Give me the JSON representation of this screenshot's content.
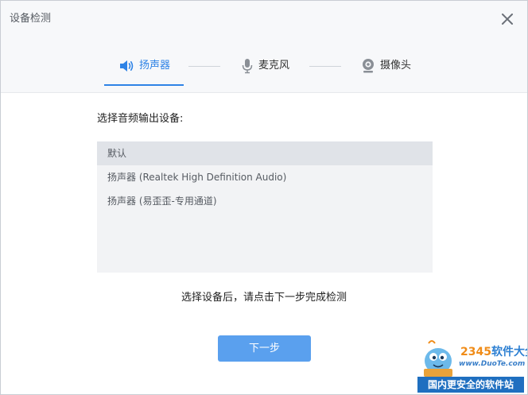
{
  "window": {
    "title": "设备检测"
  },
  "tabs": [
    {
      "label": "扬声器",
      "icon": "speaker-icon",
      "active": true
    },
    {
      "label": "麦克风",
      "icon": "microphone-icon",
      "active": false
    },
    {
      "label": "摄像头",
      "icon": "camera-icon",
      "active": false
    }
  ],
  "main": {
    "prompt": "选择音频输出设备:",
    "devices": [
      {
        "label": "默认",
        "selected": true
      },
      {
        "label": "扬声器 (Realtek High Definition Audio)",
        "selected": false
      },
      {
        "label": "扬声器 (易歪歪-专用通道)",
        "selected": false
      }
    ],
    "hint": "选择设备后，请点击下一步完成检测",
    "next_label": "下一步"
  },
  "watermark": {
    "brand_prefix": "2345",
    "brand_suffix": "软件大全",
    "url": "www.DuoTe.com",
    "bottom_text": "国内更安全的软件站"
  },
  "colors": {
    "accent": "#2e83e6",
    "button": "#5aa0ee",
    "list_bg": "#f2f3f5",
    "list_selected": "#e0e3e8"
  }
}
